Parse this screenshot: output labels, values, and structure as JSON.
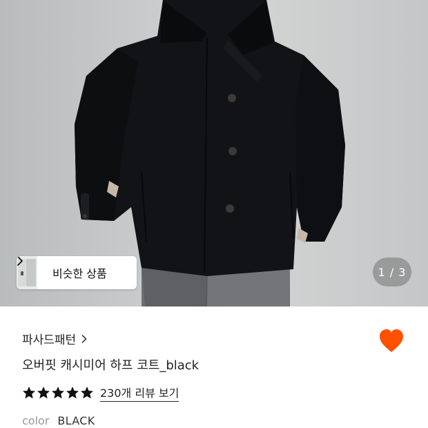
{
  "hero": {
    "image_subject": "black wool half coat worn over grey trousers",
    "similar_button_label": "비슷한 상품",
    "page_counter": "1 / 3"
  },
  "product": {
    "brand": "파사드패턴",
    "title": "오버핏 캐시미어 하프 코트_black",
    "rating_stars": 5,
    "review_link": "230개 리뷰 보기",
    "option_key": "color",
    "option_value": "BLACK",
    "wishlisted": true
  },
  "colors": {
    "heart": "#ff5000",
    "coat": "#121316",
    "text": "#222222",
    "muted": "#999999"
  },
  "icons": {
    "similar_chevron": "chevron-right-icon",
    "brand_chevron": "chevron-right-icon",
    "wishlist": "heart-icon",
    "rating": "star-icon"
  }
}
